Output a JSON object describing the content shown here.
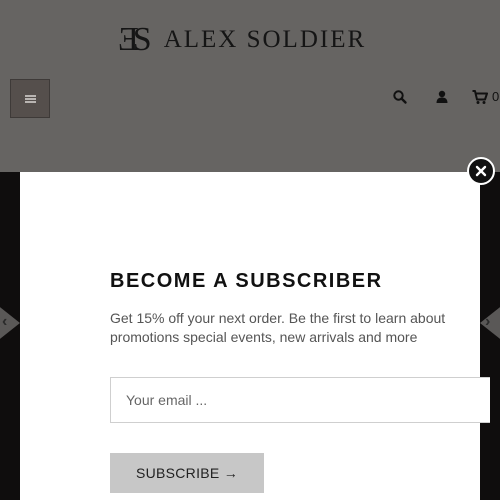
{
  "header": {
    "logo_mark": "ƎS",
    "logo_text": "ALEX SOLDIER",
    "cart_count": "0"
  },
  "icons": {
    "menu": "hamburger-icon",
    "search": "search-icon",
    "user": "user-icon",
    "cart": "cart-icon",
    "close": "close-icon",
    "prev": "chevron-left-icon",
    "next": "chevron-right-icon"
  },
  "carousel": {
    "prev_glyph": "‹",
    "next_glyph": "›"
  },
  "modal": {
    "title": "BECOME A SUBSCRIBER",
    "description": "Get 15% off your next order. Be the first to learn about promotions special events, new arrivals and more",
    "email_placeholder": "Your email ...",
    "subscribe_label": "SUBSCRIBE →"
  },
  "colors": {
    "header_bg": "#666462",
    "hero_bg": "#0f0d0d",
    "modal_bg": "#ffffff",
    "button_bg": "#c7c7c7"
  }
}
